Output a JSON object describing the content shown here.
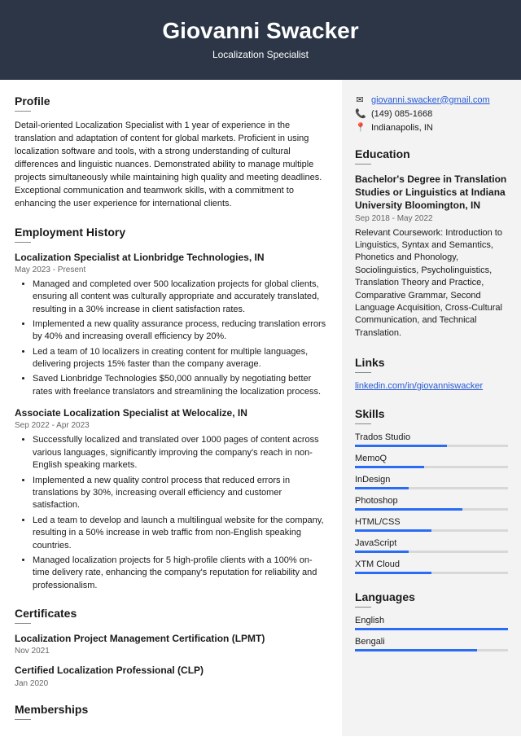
{
  "header": {
    "name": "Giovanni Swacker",
    "title": "Localization Specialist"
  },
  "profile": {
    "heading": "Profile",
    "text": "Detail-oriented Localization Specialist with 1 year of experience in the translation and adaptation of content for global markets. Proficient in using localization software and tools, with a strong understanding of cultural differences and linguistic nuances. Demonstrated ability to manage multiple projects simultaneously while maintaining high quality and meeting deadlines. Exceptional communication and teamwork skills, with a commitment to enhancing the user experience for international clients."
  },
  "employment": {
    "heading": "Employment History",
    "jobs": [
      {
        "title": "Localization Specialist at Lionbridge Technologies, IN",
        "date": "May 2023 - Present",
        "bullets": [
          "Managed and completed over 500 localization projects for global clients, ensuring all content was culturally appropriate and accurately translated, resulting in a 30% increase in client satisfaction rates.",
          "Implemented a new quality assurance process, reducing translation errors by 40% and increasing overall efficiency by 20%.",
          "Led a team of 10 localizers in creating content for multiple languages, delivering projects 15% faster than the company average.",
          "Saved Lionbridge Technologies $50,000 annually by negotiating better rates with freelance translators and streamlining the localization process."
        ]
      },
      {
        "title": "Associate Localization Specialist at Welocalize, IN",
        "date": "Sep 2022 - Apr 2023",
        "bullets": [
          "Successfully localized and translated over 1000 pages of content across various languages, significantly improving the company's reach in non-English speaking markets.",
          "Implemented a new quality control process that reduced errors in translations by 30%, increasing overall efficiency and customer satisfaction.",
          "Led a team to develop and launch a multilingual website for the company, resulting in a 50% increase in web traffic from non-English speaking countries.",
          "Managed localization projects for 5 high-profile clients with a 100% on-time delivery rate, enhancing the company's reputation for reliability and professionalism."
        ]
      }
    ]
  },
  "certificates": {
    "heading": "Certificates",
    "items": [
      {
        "title": "Localization Project Management Certification (LPMT)",
        "date": "Nov 2021"
      },
      {
        "title": "Certified Localization Professional (CLP)",
        "date": "Jan 2020"
      }
    ]
  },
  "memberships": {
    "heading": "Memberships"
  },
  "contact": {
    "email": "giovanni.swacker@gmail.com",
    "phone": "(149) 085-1668",
    "location": "Indianapolis, IN"
  },
  "education": {
    "heading": "Education",
    "degree": "Bachelor's Degree in Translation Studies or Linguistics at Indiana University Bloomington, IN",
    "date": "Sep 2018 - May 2022",
    "text": "Relevant Coursework: Introduction to Linguistics, Syntax and Semantics, Phonetics and Phonology, Sociolinguistics, Psycholinguistics, Translation Theory and Practice, Comparative Grammar, Second Language Acquisition, Cross-Cultural Communication, and Technical Translation."
  },
  "links": {
    "heading": "Links",
    "url": "linkedin.com/in/giovanniswacker"
  },
  "skills": {
    "heading": "Skills",
    "items": [
      {
        "name": "Trados Studio",
        "level": 60
      },
      {
        "name": "MemoQ",
        "level": 45
      },
      {
        "name": "InDesign",
        "level": 35
      },
      {
        "name": "Photoshop",
        "level": 70
      },
      {
        "name": "HTML/CSS",
        "level": 50
      },
      {
        "name": "JavaScript",
        "level": 35
      },
      {
        "name": "XTM Cloud",
        "level": 50
      }
    ]
  },
  "languages": {
    "heading": "Languages",
    "items": [
      {
        "name": "English",
        "level": 100
      },
      {
        "name": "Bengali",
        "level": 80
      }
    ]
  }
}
